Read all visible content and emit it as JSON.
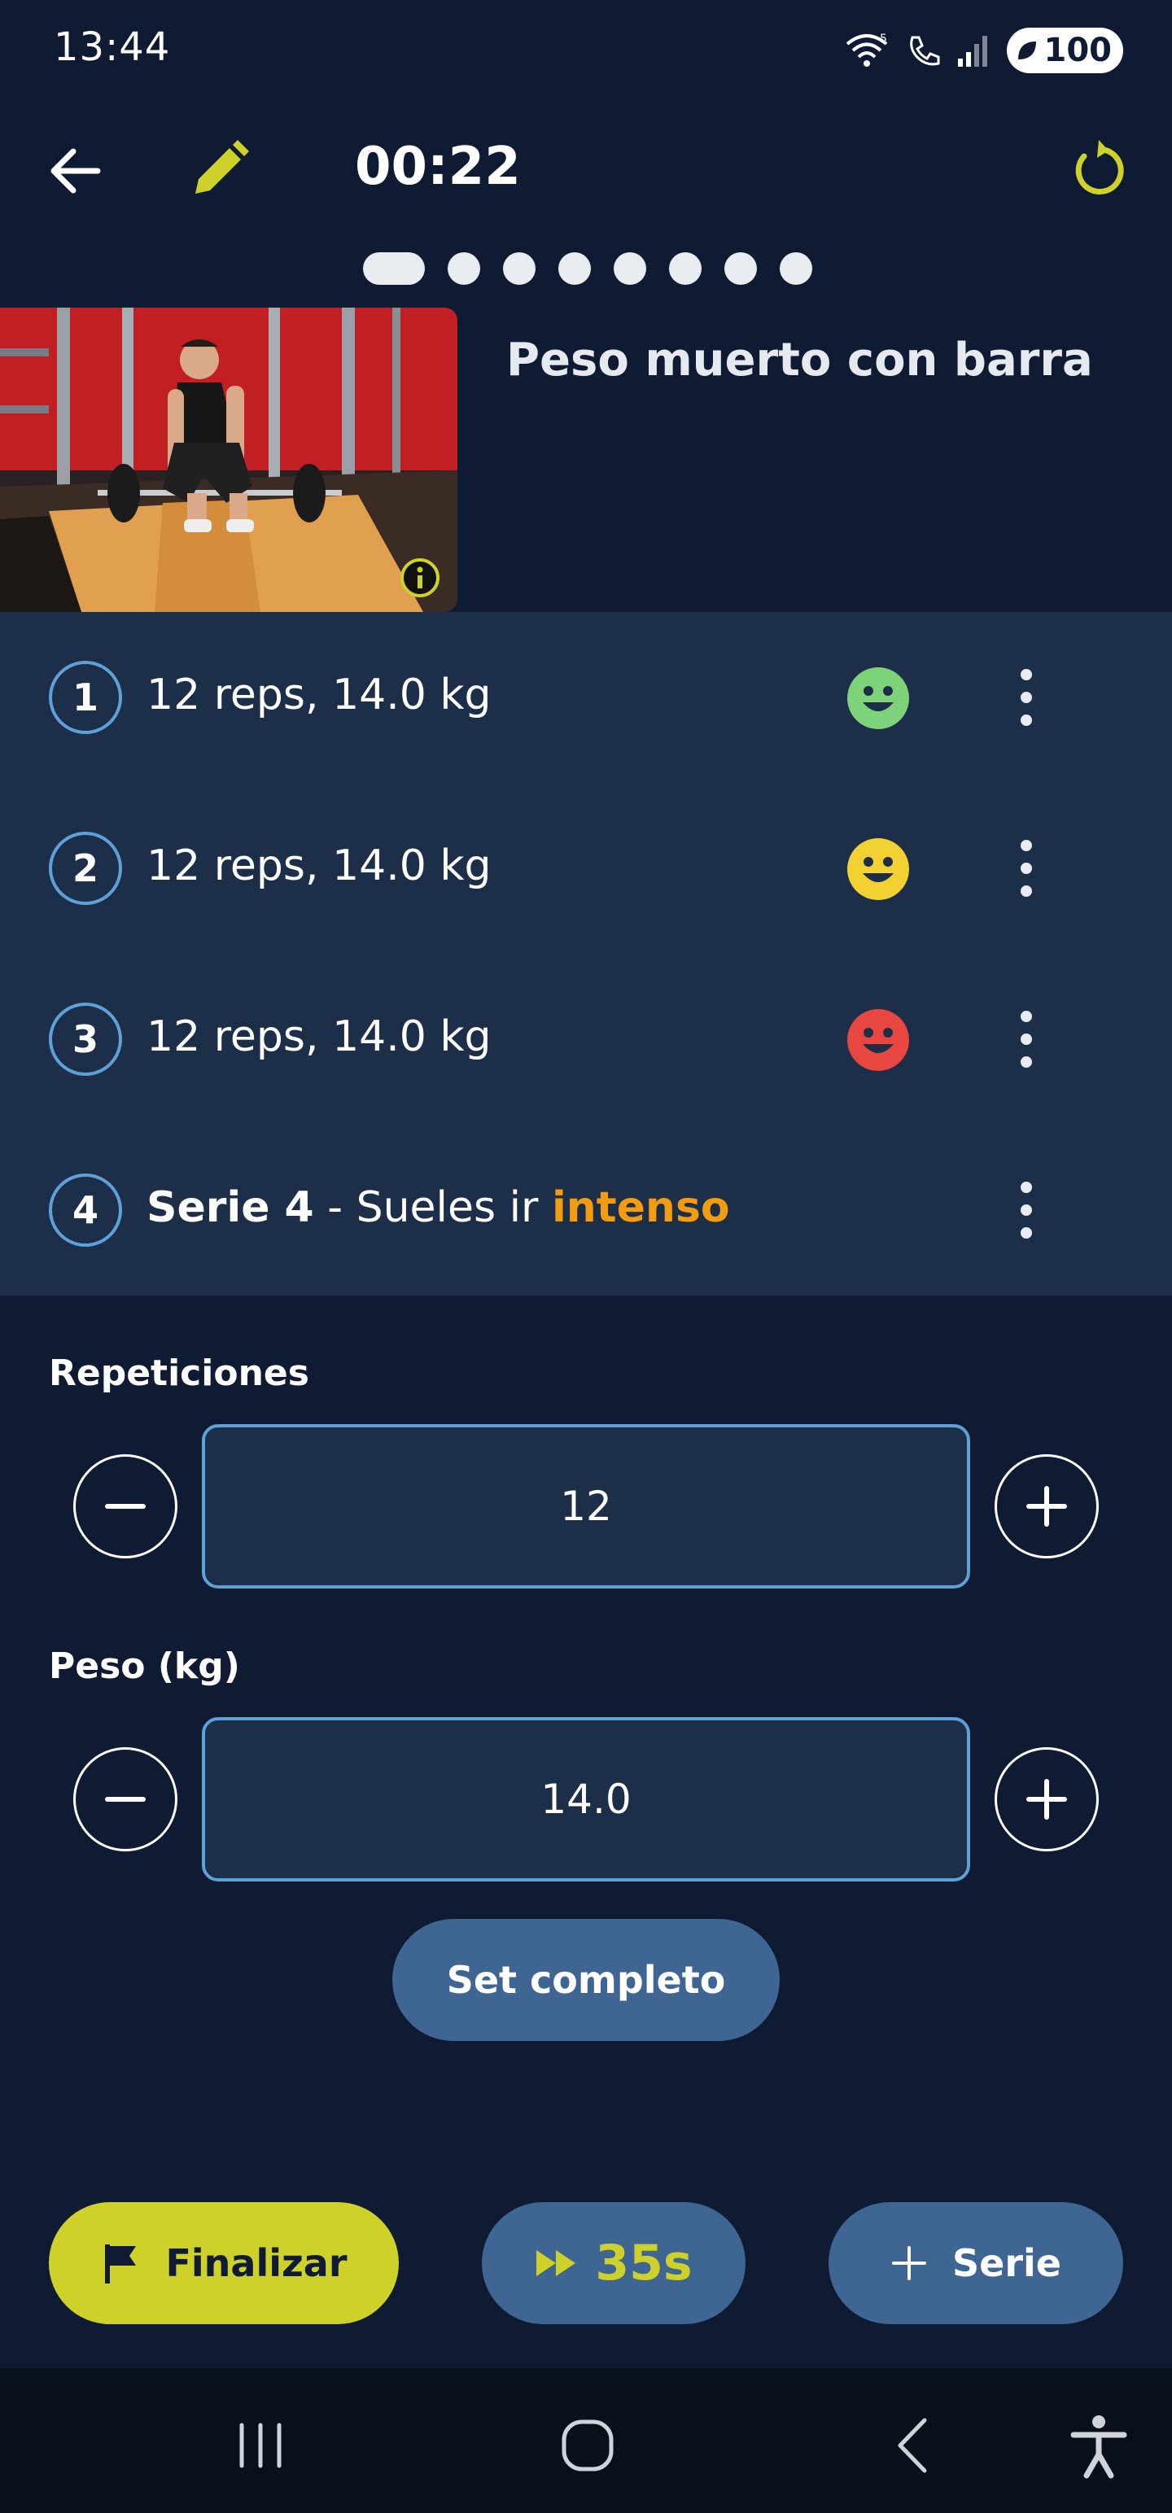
{
  "status_bar": {
    "time": "13:44",
    "battery": "100",
    "icons": [
      "wifi-calling-icon",
      "call-icon",
      "signal-icon",
      "battery-saver-icon"
    ]
  },
  "top_bar": {
    "timer": "00:22",
    "icons": [
      "back-arrow-icon",
      "pencil-icon",
      "reset-icon"
    ]
  },
  "pager": {
    "total": 8,
    "active_index": 0
  },
  "exercise": {
    "name": "Peso muerto con barra",
    "image": "barbell-deadlift-photo"
  },
  "sets": [
    {
      "number": "1",
      "text": "12 reps, 14.0 kg",
      "feeling": "happy-face-icon",
      "feeling_color": "#7ed37a"
    },
    {
      "number": "2",
      "text": "12 reps, 14.0 kg",
      "feeling": "neutral-face-icon",
      "feeling_color": "#f2d232"
    },
    {
      "number": "3",
      "text": "12 reps, 14.0 kg",
      "feeling": "hard-face-icon",
      "feeling_color": "#e84640"
    },
    {
      "number": "4",
      "title": "Serie 4",
      "text": " - Sueles ir ",
      "accent": "intenso"
    }
  ],
  "inputs": {
    "reps": {
      "label": "Repeticiones",
      "value": "12"
    },
    "weight": {
      "label": "Peso (kg)",
      "value": "14.0"
    }
  },
  "set_complete_label": "Set completo",
  "actions": {
    "finish_label": "Finalizar",
    "skip_label": "35s",
    "add_set_label": "Serie"
  },
  "colors": {
    "background": "#0f1b33",
    "panel": "#1c2e48",
    "accent_yellow": "#cdd12a",
    "button_blue": "#3f6592",
    "border_blue": "#5fa0d8",
    "intense_orange": "#f39c12"
  }
}
